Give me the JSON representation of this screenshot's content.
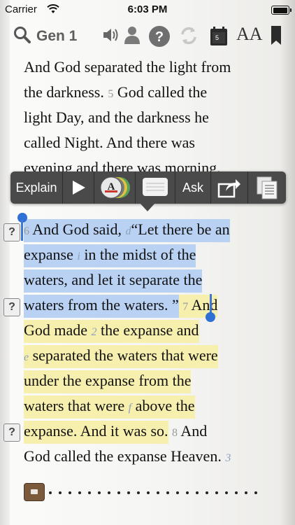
{
  "status_bar": {
    "carrier": "Carrier",
    "time": "6:03 PM",
    "battery_level": 1.0
  },
  "toolbar": {
    "reference": "Gen 1",
    "calendar_day": "5",
    "text_size_label": "AA",
    "icons": [
      "search-icon",
      "speaker-icon",
      "person-icon",
      "help-icon",
      "sync-icon",
      "calendar-icon",
      "text-size-icon",
      "bookmark-icon"
    ]
  },
  "popup_menu": {
    "explain": "Explain",
    "ask": "Ask",
    "color_letter": "A",
    "icons": [
      "play-icon",
      "highlight-colors-icon",
      "note-icon",
      "share-icon",
      "copy-icon"
    ]
  },
  "question_marker": "?",
  "verses": {
    "line1": "And God separated the light from",
    "line2a": "the darkness.",
    "line2_num": "5",
    "line2b": "God called the",
    "line3": "light Day, and the darkness he",
    "line4": "called Night. And there was",
    "line5": "evening and there was morning,",
    "v6_num": "6",
    "v6_text": "And God said,",
    "fn_d": "d",
    "v6_quote": "“Let there be an",
    "line7a": "expanse",
    "fn_i": "i",
    "line7b": "in the midst of the",
    "line8": "waters, and let it separate the",
    "line9": "waters from the waters. ”",
    "v7_num": "7",
    "v7_text": "And",
    "line10a": "God made",
    "fn_2": "2",
    "line10b": "the expanse and",
    "fn_e": "e",
    "line11": "separated the waters that were",
    "line12": "under the expanse from the",
    "line13a": "waters that were",
    "fn_f": "f",
    "line13b": "above the",
    "line14": "expanse. And it was so.",
    "v8_num": "8",
    "v8_text": "And",
    "line15": "God called the expanse Heaven.",
    "fn_3": "3"
  },
  "colors": {
    "selection": "#b9d1f3",
    "highlight": "#f7efad",
    "popup_bg": "#4a4a4a",
    "verse_number": "#9a9a9a",
    "footnote": "#8aa2bd"
  }
}
